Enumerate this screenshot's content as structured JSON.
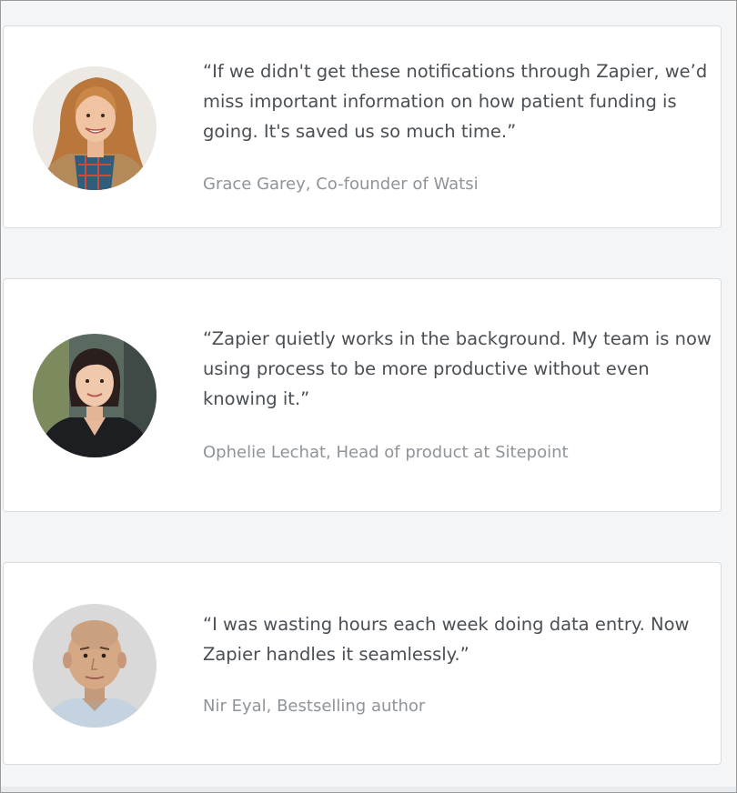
{
  "testimonials": [
    {
      "quote": "“If we didn't get these notifications through Zapier, we’d miss important information on how patient funding is going. It's saved us so much time.”",
      "author": "Grace Garey, Co-founder of Watsi",
      "avatar": "woman-blonde-avatar"
    },
    {
      "quote": "“Zapier quietly works in the background. My team is now using process to be more productive without even knowing it.”",
      "author": "Ophelie Lechat, Head of product at Sitepoint",
      "avatar": "woman-dark-hair-avatar"
    },
    {
      "quote": "“I was wasting hours each week doing data entry. Now Zapier handles it seamlessly.”",
      "author": "Nir Eyal, Bestselling author",
      "avatar": "man-bald-avatar"
    }
  ],
  "colors": {
    "page_background": "#f3f5f6",
    "card_background": "#ffffff",
    "card_border": "#d9dcde",
    "quote_text": "#4a4f54",
    "author_text": "#8f9499"
  }
}
